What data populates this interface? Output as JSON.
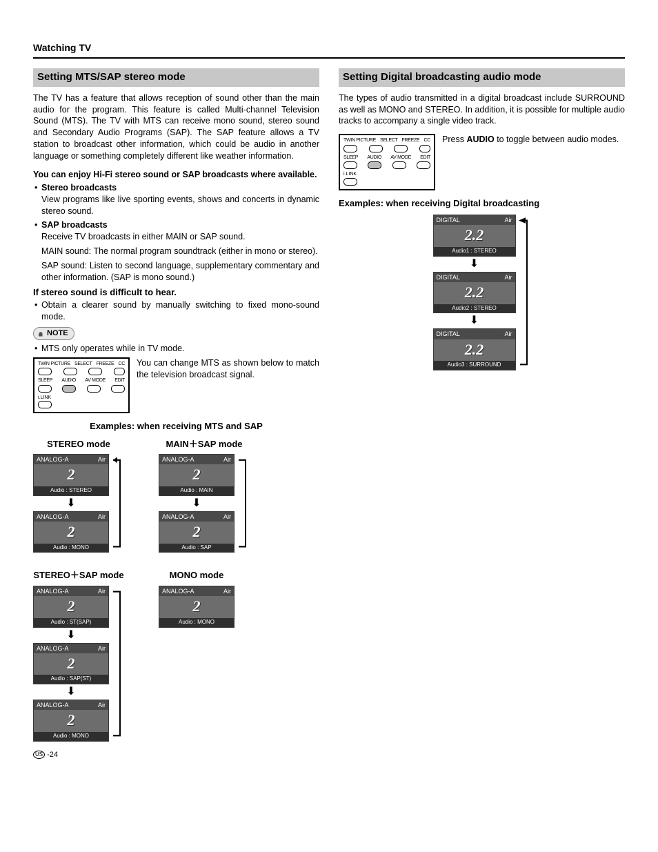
{
  "header": {
    "section": "Watching TV"
  },
  "left": {
    "heading": "Setting MTS/SAP stereo mode",
    "intro": "The TV has a feature that allows reception of sound other than the main audio for the program. This feature is called Multi-channel Television Sound (MTS). The TV with MTS can receive mono sound, stereo sound and Secondary Audio Programs (SAP). The SAP feature allows a TV station to broadcast other information, which could be audio in another language or something completely different like weather information.",
    "enjoy": "You can enjoy Hi-Fi stereo sound or SAP broadcasts where available.",
    "stereo_title": "Stereo broadcasts",
    "stereo_body": "View programs like live sporting events, shows and concerts in dynamic stereo sound.",
    "sap_title": "SAP broadcasts",
    "sap_body1": "Receive TV broadcasts in either MAIN or SAP sound.",
    "sap_body2": "MAIN sound: The normal program soundtrack (either in mono or stereo).",
    "sap_body3": "SAP sound: Listen to second language, supplementary commentary and other information. (SAP is mono sound.)",
    "difficult_heading": "If stereo sound is difficult to hear.",
    "difficult_body": "Obtain a clearer sound by manually switching to fixed mono-sound mode.",
    "note_label": "NOTE",
    "note_body": "MTS only operates while in TV mode.",
    "remote_side": "You can change MTS as shown below to match the television broadcast signal.",
    "examples_heading": "Examples: when receiving MTS and SAP",
    "remote_labels_r1": [
      "TWIN PICTURE",
      "SELECT",
      "FREEZE",
      "CC"
    ],
    "remote_labels_r2": [
      "SLEEP",
      "AUDIO",
      "AV MODE",
      "EDIT"
    ],
    "remote_labels_r3": "i.LINK",
    "modes": {
      "stereo": {
        "title": "STEREO mode",
        "osd1": {
          "tl": "ANALOG-A",
          "tr": "Air",
          "ch": "2",
          "bot": "Audio   :   STEREO"
        },
        "osd2": {
          "tl": "ANALOG-A",
          "tr": "Air",
          "ch": "2",
          "bot": "Audio   :   MONO"
        }
      },
      "mainsap": {
        "title": "MAIN＋SAP mode",
        "osd1": {
          "tl": "ANALOG-A",
          "tr": "Air",
          "ch": "2",
          "bot": "Audio   :   MAIN"
        },
        "osd2": {
          "tl": "ANALOG-A",
          "tr": "Air",
          "ch": "2",
          "bot": "Audio   :   SAP"
        }
      },
      "stereosap": {
        "title": "STEREO＋SAP mode",
        "osd1": {
          "tl": "ANALOG-A",
          "tr": "Air",
          "ch": "2",
          "bot": "Audio   :   ST(SAP)"
        },
        "osd2": {
          "tl": "ANALOG-A",
          "tr": "Air",
          "ch": "2",
          "bot": "Audio   :   SAP(ST)"
        },
        "osd3": {
          "tl": "ANALOG-A",
          "tr": "Air",
          "ch": "2",
          "bot": "Audio   :   MONO"
        }
      },
      "mono": {
        "title": "MONO mode",
        "osd1": {
          "tl": "ANALOG-A",
          "tr": "Air",
          "ch": "2",
          "bot": "Audio   :   MONO"
        }
      }
    }
  },
  "right": {
    "heading": "Setting Digital broadcasting audio mode",
    "intro": "The types of audio transmitted in a digital broadcast include SURROUND as well as MONO and STEREO. In addition, it is possible for multiple audio tracks to accompany a single video track.",
    "press_audio_pre": "Press ",
    "press_audio_bold": "AUDIO",
    "press_audio_post": " to toggle between audio modes.",
    "examples_heading": "Examples: when receiving Digital broadcasting",
    "osd1": {
      "tl": "DIGITAL",
      "tr": "Air",
      "ch": "2.2",
      "bot": "Audio1   :   STEREO"
    },
    "osd2": {
      "tl": "DIGITAL",
      "tr": "Air",
      "ch": "2.2",
      "bot": "Audio2   :   STEREO"
    },
    "osd3": {
      "tl": "DIGITAL",
      "tr": "Air",
      "ch": "2.2",
      "bot": "Audio3   :   SURROUND"
    }
  },
  "footer": {
    "region": "US",
    "page": "-24"
  }
}
